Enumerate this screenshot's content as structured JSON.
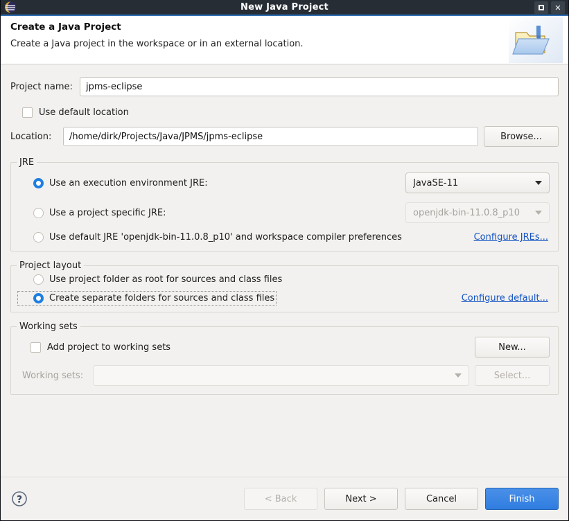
{
  "window": {
    "title": "New Java Project",
    "app_icon": "eclipse-logo-icon",
    "maximize_label": "",
    "close_label": "✕"
  },
  "header": {
    "title": "Create a Java Project",
    "subtitle": "Create a Java project in the workspace or in an external location.",
    "icon": "java-project-folder-icon"
  },
  "project_name": {
    "label": "Project name:",
    "value": "jpms-eclipse",
    "placeholder": ""
  },
  "location": {
    "use_default_label": "Use default location",
    "use_default_checked": false,
    "label": "Location:",
    "value": "/home/dirk/Projects/Java/JPMS/jpms-eclipse",
    "browse_label": "Browse..."
  },
  "jre": {
    "legend": "JRE",
    "options": [
      {
        "label": "Use an execution environment JRE:",
        "selected": true
      },
      {
        "label": "Use a project specific JRE:",
        "selected": false
      },
      {
        "label": "Use default JRE 'openjdk-bin-11.0.8_p10' and workspace compiler preferences",
        "selected": false
      }
    ],
    "execution_env_value": "JavaSE-11",
    "project_jre_value": "openjdk-bin-11.0.8_p10",
    "configure_link": "Configure JREs..."
  },
  "project_layout": {
    "legend": "Project layout",
    "options": [
      {
        "label": "Use project folder as root for sources and class files",
        "selected": false
      },
      {
        "label": "Create separate folders for sources and class files",
        "selected": true
      }
    ],
    "configure_link": "Configure default..."
  },
  "working_sets": {
    "legend": "Working sets",
    "add_label": "Add project to working sets",
    "add_checked": false,
    "new_label": "New...",
    "sets_label": "Working sets:",
    "sets_value": "",
    "select_label": "Select..."
  },
  "footer": {
    "help_icon": "help-question-icon",
    "back_label": "< Back",
    "next_label": "Next >",
    "cancel_label": "Cancel",
    "finish_label": "Finish"
  },
  "colors": {
    "titlebar": "#262d35",
    "accent": "#2f7de0",
    "link": "#1453c4",
    "radio_on": "#1f7fe0"
  }
}
